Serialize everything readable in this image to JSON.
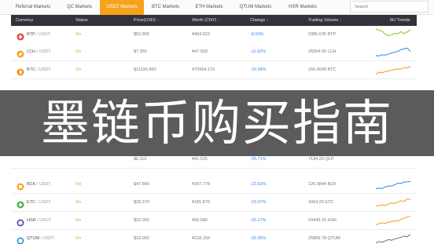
{
  "tabs": {
    "items": [
      {
        "label": "Referral Markets"
      },
      {
        "label": "QC Markets"
      },
      {
        "label": "USDT Markets"
      },
      {
        "label": "BTC Markets"
      },
      {
        "label": "ETH Markets"
      },
      {
        "label": "QTUM Markets"
      },
      {
        "label": "HSR Markets"
      }
    ],
    "active_index": 2,
    "search_placeholder": "Search"
  },
  "table": {
    "columns": {
      "currency": "Currency",
      "status": "Status",
      "price": "Price(USD)",
      "worth": "Worth (CNY)",
      "change": "Change",
      "volume": "Trading Volume",
      "trends": "6H Trends"
    },
    "sort_glyph": "↕",
    "rows": [
      {
        "base": "BTP",
        "quote": "USDT",
        "status": "On",
        "price": "$62.800",
        "worth": "¥404.023",
        "change": "-8.00%",
        "volume": "5385.635 BTP",
        "icon_color": "#e2413b",
        "icon": "diamond",
        "trend": [
          0.95,
          0.85,
          0.78,
          0.55,
          0.45,
          0.5,
          0.62,
          0.58,
          0.75,
          0.6,
          0.72,
          0.9
        ],
        "trend_color": "#8cc63f"
      },
      {
        "base": "LCH",
        "quote": "USDT",
        "status": "On",
        "price": "$7.350",
        "worth": "¥47.028",
        "change": "-11.92%",
        "volume": "26554.56 LCH",
        "icon_color": "#f5a623",
        "icon": "leaf",
        "trend": [
          0.25,
          0.22,
          0.3,
          0.28,
          0.35,
          0.45,
          0.5,
          0.55,
          0.7,
          0.75,
          0.8,
          0.55
        ],
        "trend_color": "#3b8ee8"
      },
      {
        "base": "BTC",
        "quote": "USDT",
        "status": "On",
        "price": "$11026.860",
        "worth": "¥70954.170",
        "change": "-15.58%",
        "volume": "160.4598 BTC",
        "icon_color": "#f7931a",
        "icon": "btc",
        "trend": [
          0.2,
          0.35,
          0.3,
          0.4,
          0.45,
          0.5,
          0.55,
          0.6,
          0.58,
          0.7,
          0.65,
          0.8
        ],
        "trend_color": "#f5a623"
      },
      {
        "base": "BCK",
        "quote": "USDT",
        "status": "On",
        "price": "$47.840",
        "worth": "¥307.778",
        "change": "-22.63%",
        "volume": "126.0844 BCK",
        "icon_color": "#f5a623",
        "icon": "cube",
        "trend": [
          0.2,
          0.25,
          0.22,
          0.35,
          0.4,
          0.42,
          0.5,
          0.62,
          0.6,
          0.7,
          0.72,
          0.75
        ],
        "trend_color": "#3b8ee8"
      },
      {
        "base": "ETC",
        "quote": "USDT",
        "status": "On",
        "price": "$28.270",
        "worth": "¥181.875",
        "change": "-23.07%",
        "volume": "4364.25 ETC",
        "icon_color": "#4caf50",
        "icon": "diamond",
        "trend": [
          0.25,
          0.3,
          0.35,
          0.3,
          0.4,
          0.5,
          0.45,
          0.55,
          0.65,
          0.6,
          0.8,
          0.75
        ],
        "trend_color": "#f5a623"
      },
      {
        "base": "HSR",
        "quote": "USDT",
        "status": "On",
        "price": "$10.350",
        "worth": "¥66.586",
        "change": "-26.17%",
        "volume": "24443.15 HSR",
        "icon_color": "#6a3fb5",
        "icon": "hex",
        "trend": [
          0.2,
          0.28,
          0.35,
          0.3,
          0.4,
          0.45,
          0.5,
          0.48,
          0.6,
          0.7,
          0.78,
          0.85
        ],
        "trend_color": "#f5a623"
      },
      {
        "base": "QTUM",
        "quote": "USDT",
        "status": "On",
        "price": "$33.950",
        "worth": "¥218.159",
        "change": "-26.36%",
        "volume": "25889.78 QTUM",
        "icon_color": "#2e9ad0",
        "icon": "hex",
        "trend": [
          0.2,
          0.3,
          0.25,
          0.35,
          0.45,
          0.4,
          0.5,
          0.55,
          0.62,
          0.72,
          0.65,
          0.85
        ],
        "trend_color": "#777777"
      }
    ],
    "partial_row": {
      "price": "$6.110",
      "worth": "¥41.515",
      "change": "-25.71%",
      "volume": "7194.20 QLP"
    }
  },
  "overlay": {
    "text": "墨链币购买指南"
  }
}
